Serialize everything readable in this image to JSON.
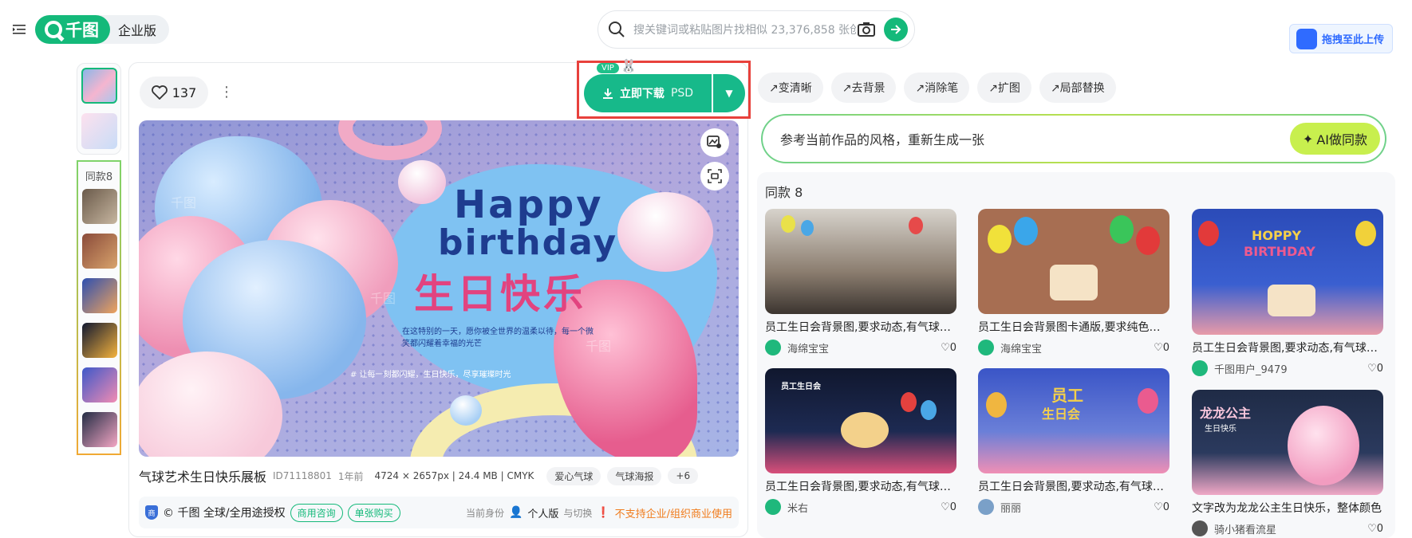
{
  "header": {
    "logo_text": "千图",
    "enterprise_label": "企业版",
    "search_placeholder": "搜关键词或粘贴图片找相似 23,376,858 张创意",
    "upload_label": "拖拽至此上传"
  },
  "rail": {
    "same_label": "同款8"
  },
  "detail": {
    "likes": "137",
    "vip_tag": "VIP",
    "download_label": "立即下载",
    "download_format": "PSD",
    "poster": {
      "line1": "Happy",
      "line2": "birthday",
      "line3": "生日快乐",
      "small_text": "在这特别的一天，愿你被全世界的温柔以待，每一个微笑都闪耀着幸福的光芒",
      "tag_text": "# 让每一刻都闪耀，生日快乐，尽享璀璨时光",
      "watermark": "千图"
    },
    "title": "气球艺术生日快乐展板",
    "id": "ID71118801",
    "age": "1年前",
    "specs": "4724 × 2657px | 24.4 MB | CMYK",
    "tags": [
      "爱心气球",
      "气球海报",
      "+6"
    ],
    "license": {
      "shield": "商",
      "brand": "© 千图 全球/全用途授权",
      "consult": "商用咨询",
      "single": "单张购买",
      "identity_label": "当前身份",
      "identity": "个人版",
      "switch": "与切换",
      "warning": "不支持企业/组织商业使用"
    }
  },
  "tools": [
    "↗变清晰",
    "↗去背景",
    "↗消除笔",
    "↗扩图",
    "↗局部替换"
  ],
  "ai": {
    "prompt": "参考当前作品的风格，重新生成一张",
    "button": "AI做同款"
  },
  "same": {
    "title": "同款 8",
    "items": [
      {
        "caption": "员工生日会背景图,要求动态,有气球动画",
        "author": "海绵宝宝",
        "likes": "0"
      },
      {
        "caption": "员工生日会背景图卡通版,要求纯色背景",
        "author": "海绵宝宝",
        "likes": "0"
      },
      {
        "caption": "员工生日会背景图,要求动态,有气球动画",
        "author": "千图用户_9479",
        "likes": "0"
      },
      {
        "caption": "员工生日会背景图,要求动态,有气球动画",
        "author": "米右",
        "likes": "0"
      },
      {
        "caption": "员工生日会背景图,要求动态,有气球动画",
        "author": "丽丽",
        "likes": "0"
      },
      {
        "caption": "文字改为龙龙公主生日快乐，整体颜色",
        "author": "骑小猪看流星",
        "likes": "0"
      }
    ],
    "image_texts": {
      "img3_line1": "HOPPY",
      "img3_line2": "BIRTHDAY",
      "img4_title": "员工生日会",
      "img5_line1": "员工",
      "img5_line2": "生日会",
      "img6_line1": "龙龙公主",
      "img6_line2": "生日快乐"
    }
  },
  "colors": {
    "brand_green": "#14b97a",
    "download_green": "#17b98a",
    "highlight_red": "#e8413c",
    "warning_orange": "#f07b1c"
  }
}
